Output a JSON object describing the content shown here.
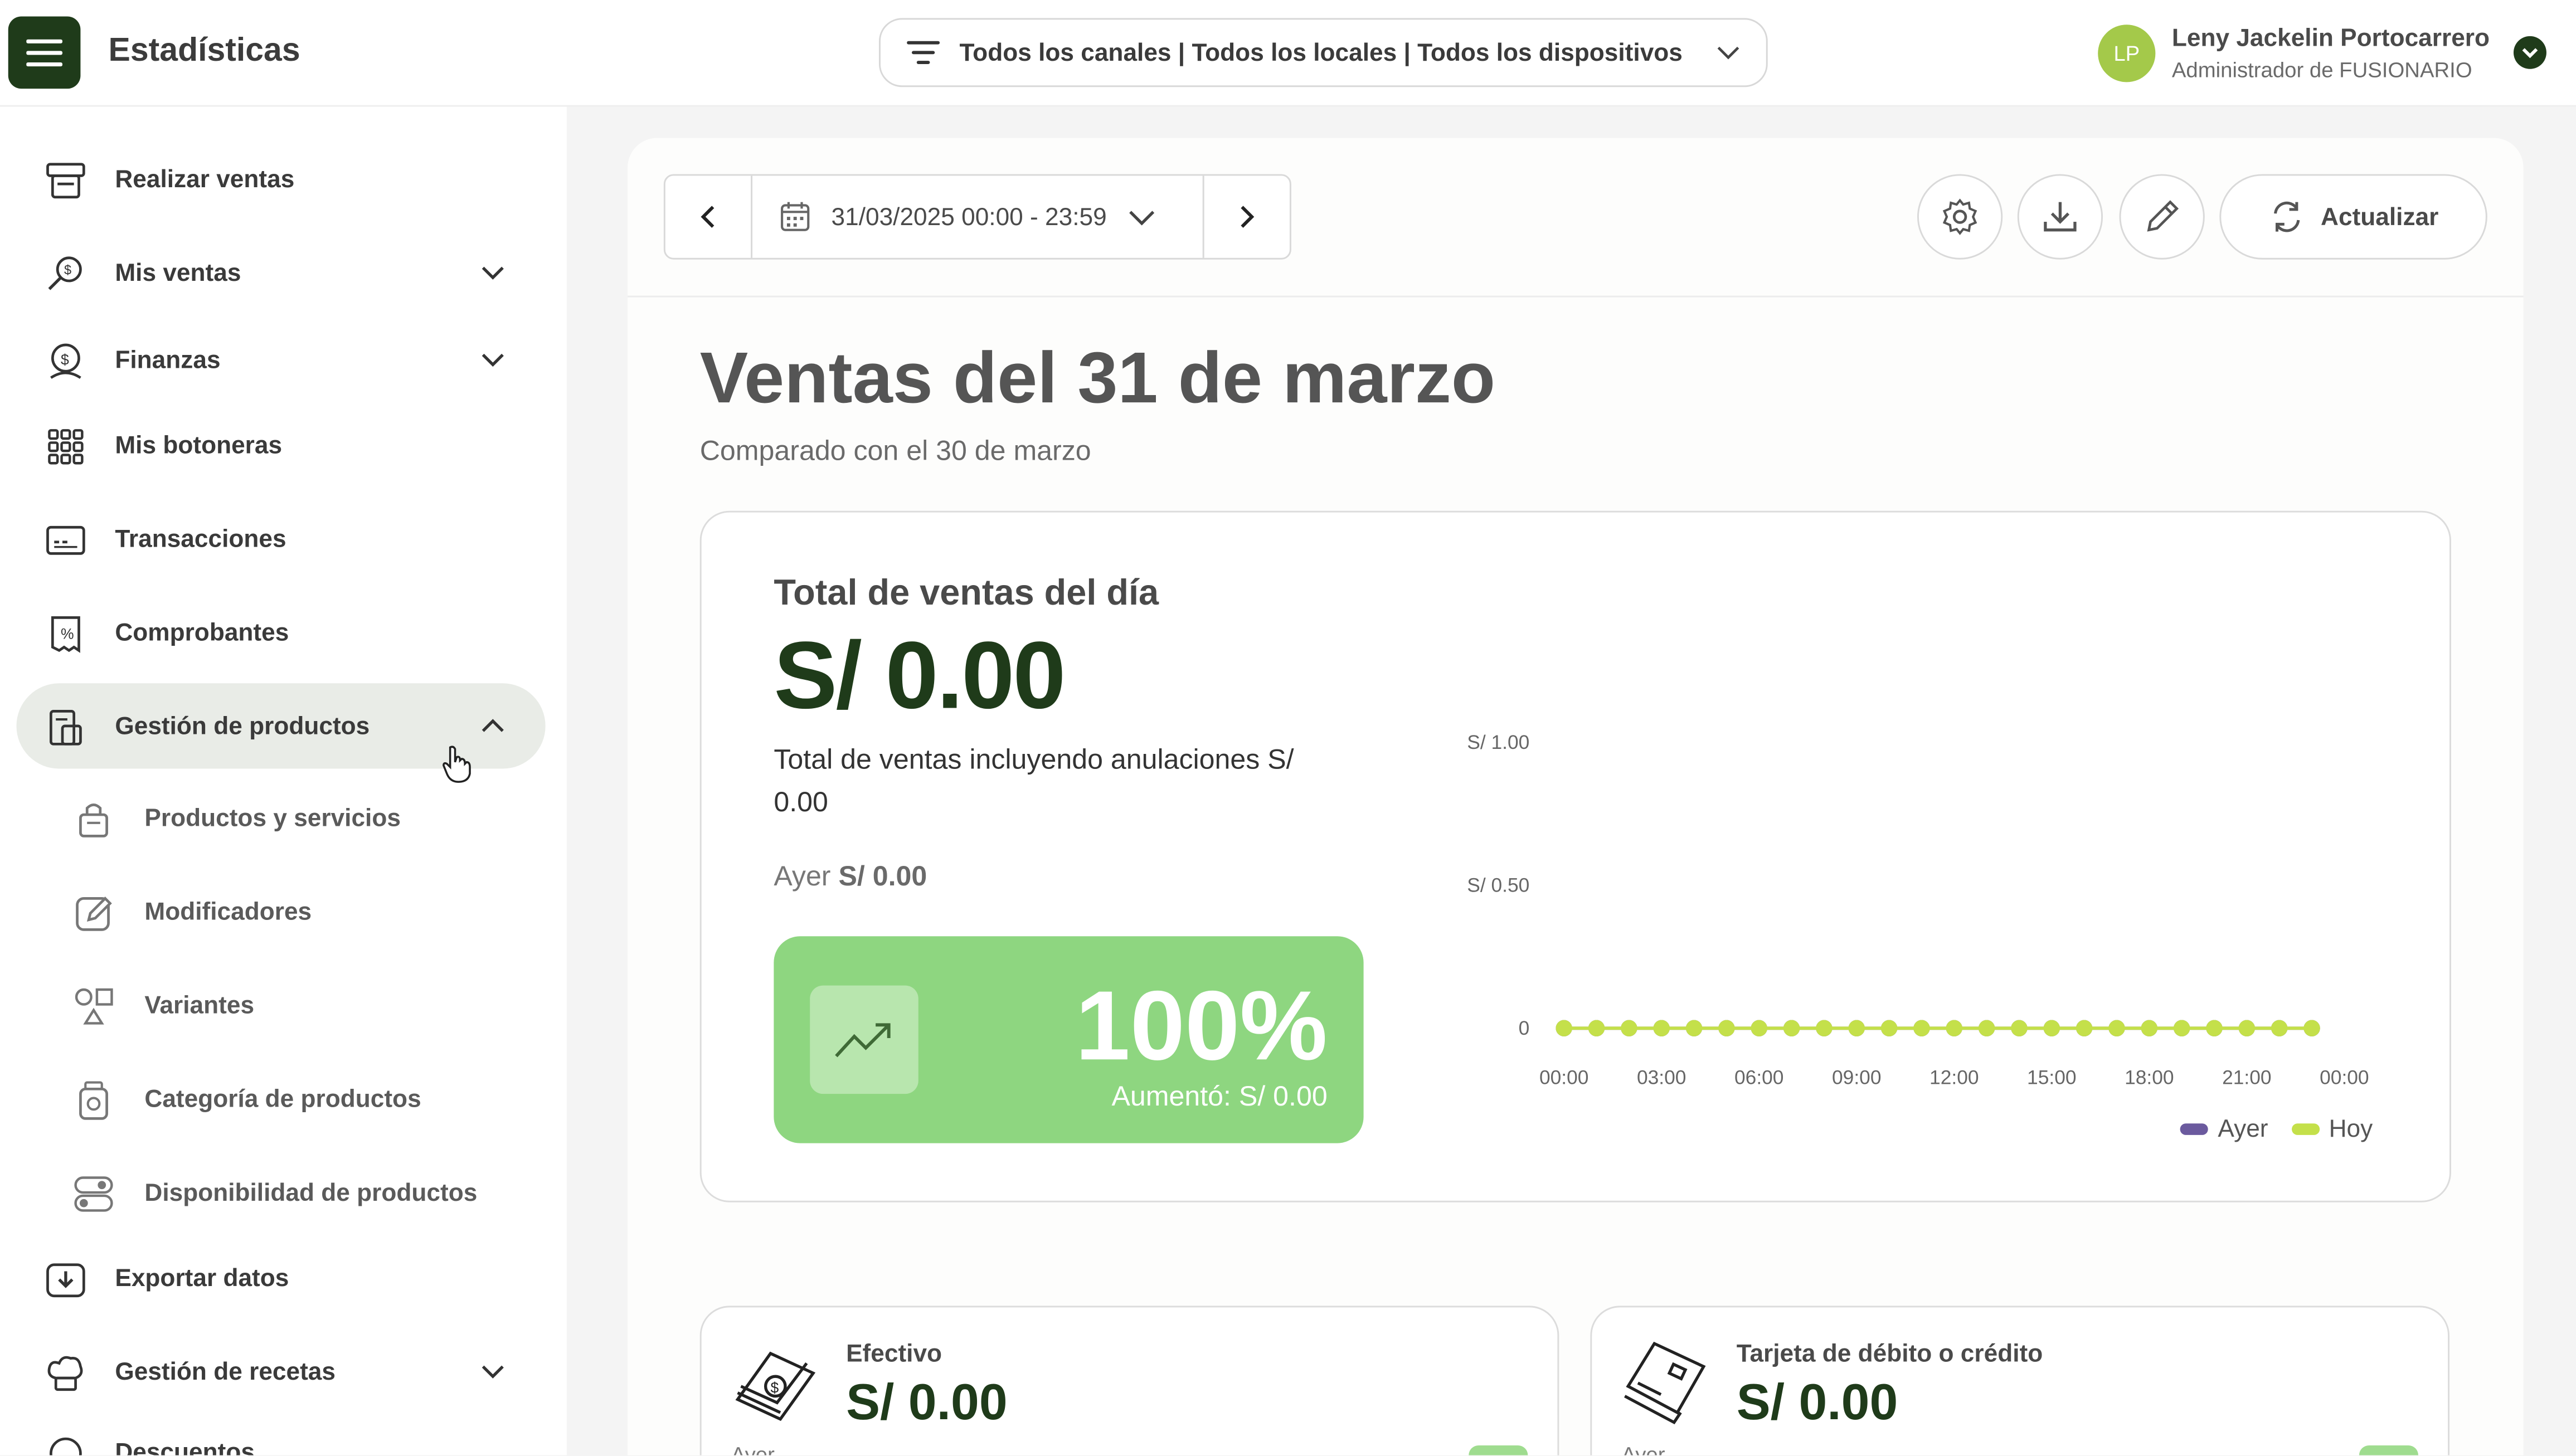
{
  "header": {
    "title": "Estadísticas",
    "filter": "Todos los canales | Todos los locales | Todos los dispositivos",
    "user_initials": "LP",
    "user_name": "Leny Jackelin Portocarrero",
    "user_role": "Administrador de FUSIONARIO"
  },
  "sidebar": {
    "items": [
      {
        "label": "Realizar ventas",
        "icon": "register-icon"
      },
      {
        "label": "Mis ventas",
        "icon": "search-tag-icon"
      },
      {
        "label": "Finanzas",
        "icon": "finance-icon"
      },
      {
        "label": "Mis botoneras",
        "icon": "grid-icon"
      },
      {
        "label": "Transacciones",
        "icon": "card-terminal-icon"
      },
      {
        "label": "Comprobantes",
        "icon": "receipt-icon"
      },
      {
        "label": "Gestión de productos",
        "icon": "product-box-icon"
      },
      {
        "label": "Exportar datos",
        "icon": "download-box-icon"
      },
      {
        "label": "Gestión de recetas",
        "icon": "chef-icon"
      },
      {
        "label": "Descuentos",
        "icon": "discount-icon"
      }
    ],
    "subitems": [
      {
        "label": "Productos y servicios",
        "icon": "bag-icon"
      },
      {
        "label": "Modificadores",
        "icon": "edit-icon"
      },
      {
        "label": "Variantes",
        "icon": "shapes-icon"
      },
      {
        "label": "Categoría de productos",
        "icon": "jar-icon"
      },
      {
        "label": "Disponibilidad de productos",
        "icon": "toggle-icon"
      }
    ]
  },
  "toolbar": {
    "date_range": "31/03/2025 00:00 - 23:59",
    "refresh_label": "Actualizar"
  },
  "page": {
    "title": "Ventas del 31 de marzo",
    "subtitle": "Comparado con el 30 de marzo"
  },
  "summary": {
    "title": "Total de ventas del día",
    "total": "S/ 0.00",
    "including_cancellations": "Total de ventas incluyendo anulaciones S/ 0.00",
    "yesterday_label": "Ayer",
    "yesterday_value": "S/ 0.00",
    "change_percent": "100%",
    "change_text": "Aumentó: S/ 0.00"
  },
  "chart_data": {
    "type": "line",
    "y_ticks": [
      "S/ 1.00",
      "S/ 0.50",
      "0"
    ],
    "ylim": [
      0,
      1
    ],
    "x_ticks": [
      "00:00",
      "03:00",
      "06:00",
      "09:00",
      "12:00",
      "15:00",
      "18:00",
      "21:00",
      "00:00"
    ],
    "x_hours": [
      0,
      1,
      2,
      3,
      4,
      5,
      6,
      7,
      8,
      9,
      10,
      11,
      12,
      13,
      14,
      15,
      16,
      17,
      18,
      19,
      20,
      21,
      22,
      23
    ],
    "xlim": [
      0,
      24
    ],
    "series": [
      {
        "name": "Ayer",
        "color": "#6b5a9e",
        "values": [
          0,
          0,
          0,
          0,
          0,
          0,
          0,
          0,
          0,
          0,
          0,
          0,
          0,
          0,
          0,
          0,
          0,
          0,
          0,
          0,
          0,
          0,
          0,
          0
        ]
      },
      {
        "name": "Hoy",
        "color": "#c4e04a",
        "values": [
          0,
          0,
          0,
          0,
          0,
          0,
          0,
          0,
          0,
          0,
          0,
          0,
          0,
          0,
          0,
          0,
          0,
          0,
          0,
          0,
          0,
          0,
          0,
          0
        ]
      }
    ],
    "legend_position": "bottom-right"
  },
  "payments": [
    {
      "label": "Efectivo",
      "value": "S/ 0.00",
      "ayer": "Ayer"
    },
    {
      "label": "Tarjeta de débito o crédito",
      "value": "S/ 0.00",
      "ayer": "Ayer"
    }
  ],
  "colors": {
    "brand_dark": "#1f3b1a",
    "accent_green": "#8ed680",
    "avatar": "#a4c94a"
  }
}
